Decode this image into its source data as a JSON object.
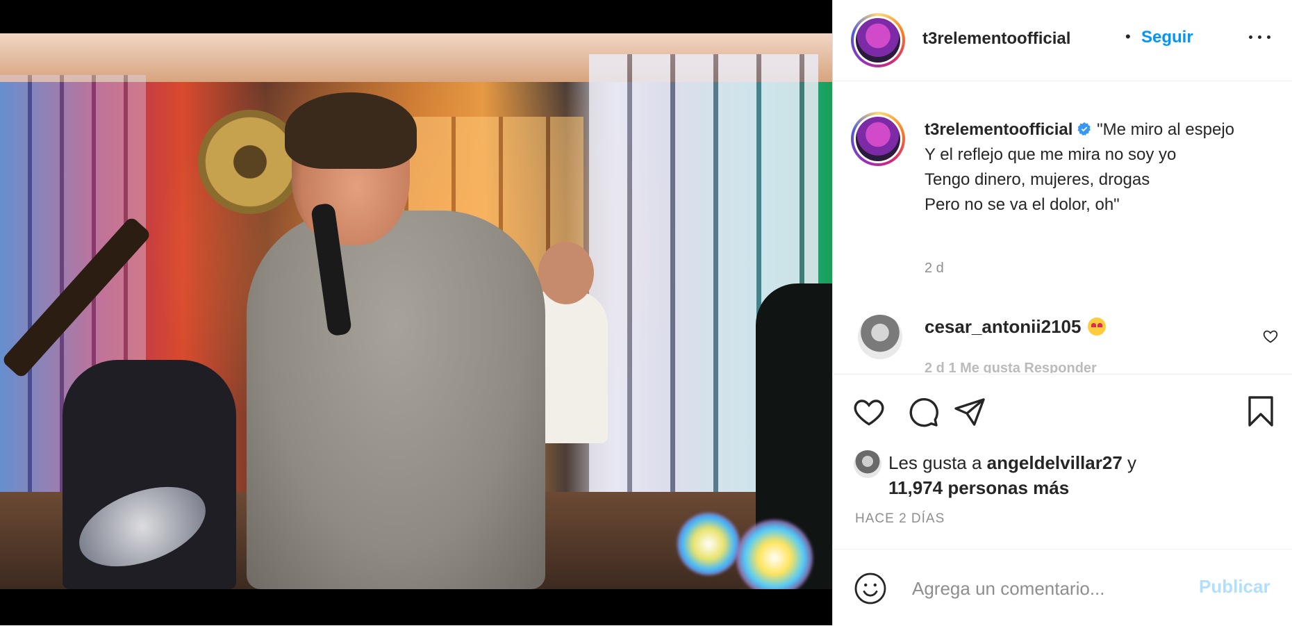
{
  "media": {
    "alt": "photo"
  },
  "header": {
    "username": "t3relementoofficial",
    "separator": "•",
    "follow_label": "Seguir"
  },
  "caption": {
    "username": "t3relementoofficial",
    "text": "\"Me miro al espejo\nY el reflejo que me mira no soy yo\nTengo dinero, mujeres, drogas\nPero no se va el dolor, oh\"",
    "time": "2 d"
  },
  "comments": [
    {
      "username": "cesar_antonii2105",
      "emoji": "heart-eyes",
      "meta": "2 d  1 Me gusta  Responder"
    }
  ],
  "likes": {
    "prefix": "Les gusta a",
    "user": "angeldelvillar27",
    "joiner": "y",
    "others": "11,974 personas más"
  },
  "date_label": "HACE 2 DÍAS",
  "add_comment": {
    "placeholder": "Agrega un comentario...",
    "post_label": "Publicar"
  },
  "colors": {
    "accent": "#0095f6",
    "post_disabled": "#b2dffc",
    "text": "#262626",
    "muted": "#8e8e8e"
  }
}
